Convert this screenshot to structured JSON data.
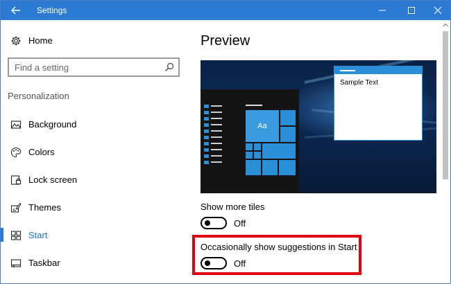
{
  "window": {
    "title": "Settings",
    "accent_color": "#2b7bd4",
    "buttons": [
      "minimize-icon",
      "maximize-icon",
      "close-icon"
    ]
  },
  "sidebar": {
    "home_label": "Home",
    "search": {
      "placeholder": "Find a setting"
    },
    "section_title": "Personalization",
    "items": [
      {
        "label": "Background",
        "icon": "picture-icon",
        "active": false
      },
      {
        "label": "Colors",
        "icon": "palette-icon",
        "active": false
      },
      {
        "label": "Lock screen",
        "icon": "lock-screen-icon",
        "active": false
      },
      {
        "label": "Themes",
        "icon": "brush-icon",
        "active": false
      },
      {
        "label": "Start",
        "icon": "start-tiles-icon",
        "active": true
      },
      {
        "label": "Taskbar",
        "icon": "taskbar-icon",
        "active": false
      }
    ]
  },
  "content": {
    "title": "Preview",
    "preview": {
      "tile_text": "Aa",
      "sample_text": "Sample Text"
    },
    "settings": [
      {
        "label": "Show more tiles",
        "state": "Off",
        "on": false
      },
      {
        "label": "Occasionally show suggestions in Start",
        "state": "Off",
        "on": false,
        "highlighted": true
      }
    ]
  },
  "colors": {
    "highlight": "#e3000f",
    "active_nav": "#1e6fc5"
  }
}
